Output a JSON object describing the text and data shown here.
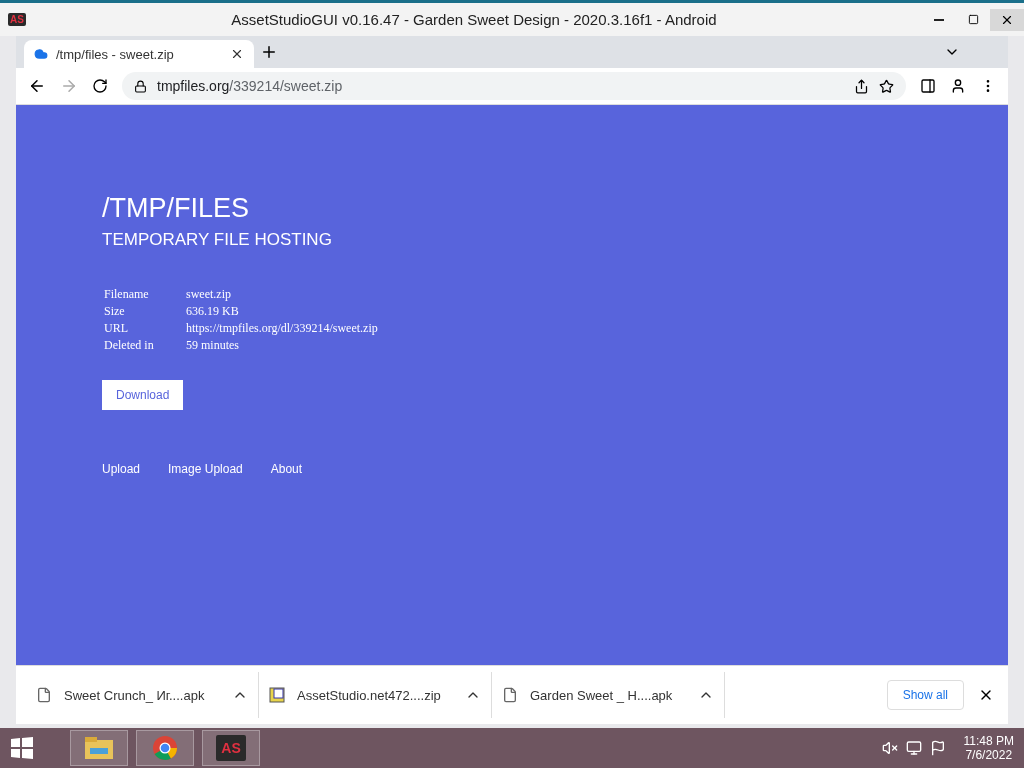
{
  "app_window": {
    "logo": "AS",
    "title": "AssetStudioGUI v0.16.47 - Garden Sweet Design - 2020.3.16f1 - Android"
  },
  "browser": {
    "tabs": [
      {
        "title": "/tmp/files - sweet.zip",
        "selected": true
      }
    ],
    "address": {
      "domain": "tmpfiles.org",
      "path": "/339214/sweet.zip"
    }
  },
  "page": {
    "title": "/TMP/FILES",
    "subtitle": "TEMPORARY FILE HOSTING",
    "details": [
      {
        "label": "Filename",
        "value": "sweet.zip"
      },
      {
        "label": "Size",
        "value": "636.19 KB"
      },
      {
        "label": "URL",
        "value": "https://tmpfiles.org/dl/339214/sweet.zip"
      },
      {
        "label": "Deleted in",
        "value": "59 minutes"
      }
    ],
    "download_button": "Download",
    "links": [
      "Upload",
      "Image Upload",
      "About"
    ]
  },
  "downloads": {
    "items": [
      {
        "name": "Sweet Crunch_ Иг....apk",
        "kind": "file"
      },
      {
        "name": "AssetStudio.net472....zip",
        "kind": "archive"
      },
      {
        "name": "Garden Sweet _ H....apk",
        "kind": "file"
      }
    ],
    "show_all": "Show all"
  },
  "taskbar": {
    "apps": [
      {
        "kind": "explorer"
      },
      {
        "kind": "chrome"
      },
      {
        "kind": "assetstudio",
        "label": "AS"
      }
    ],
    "time": "11:48 PM",
    "date": "7/6/2022"
  }
}
